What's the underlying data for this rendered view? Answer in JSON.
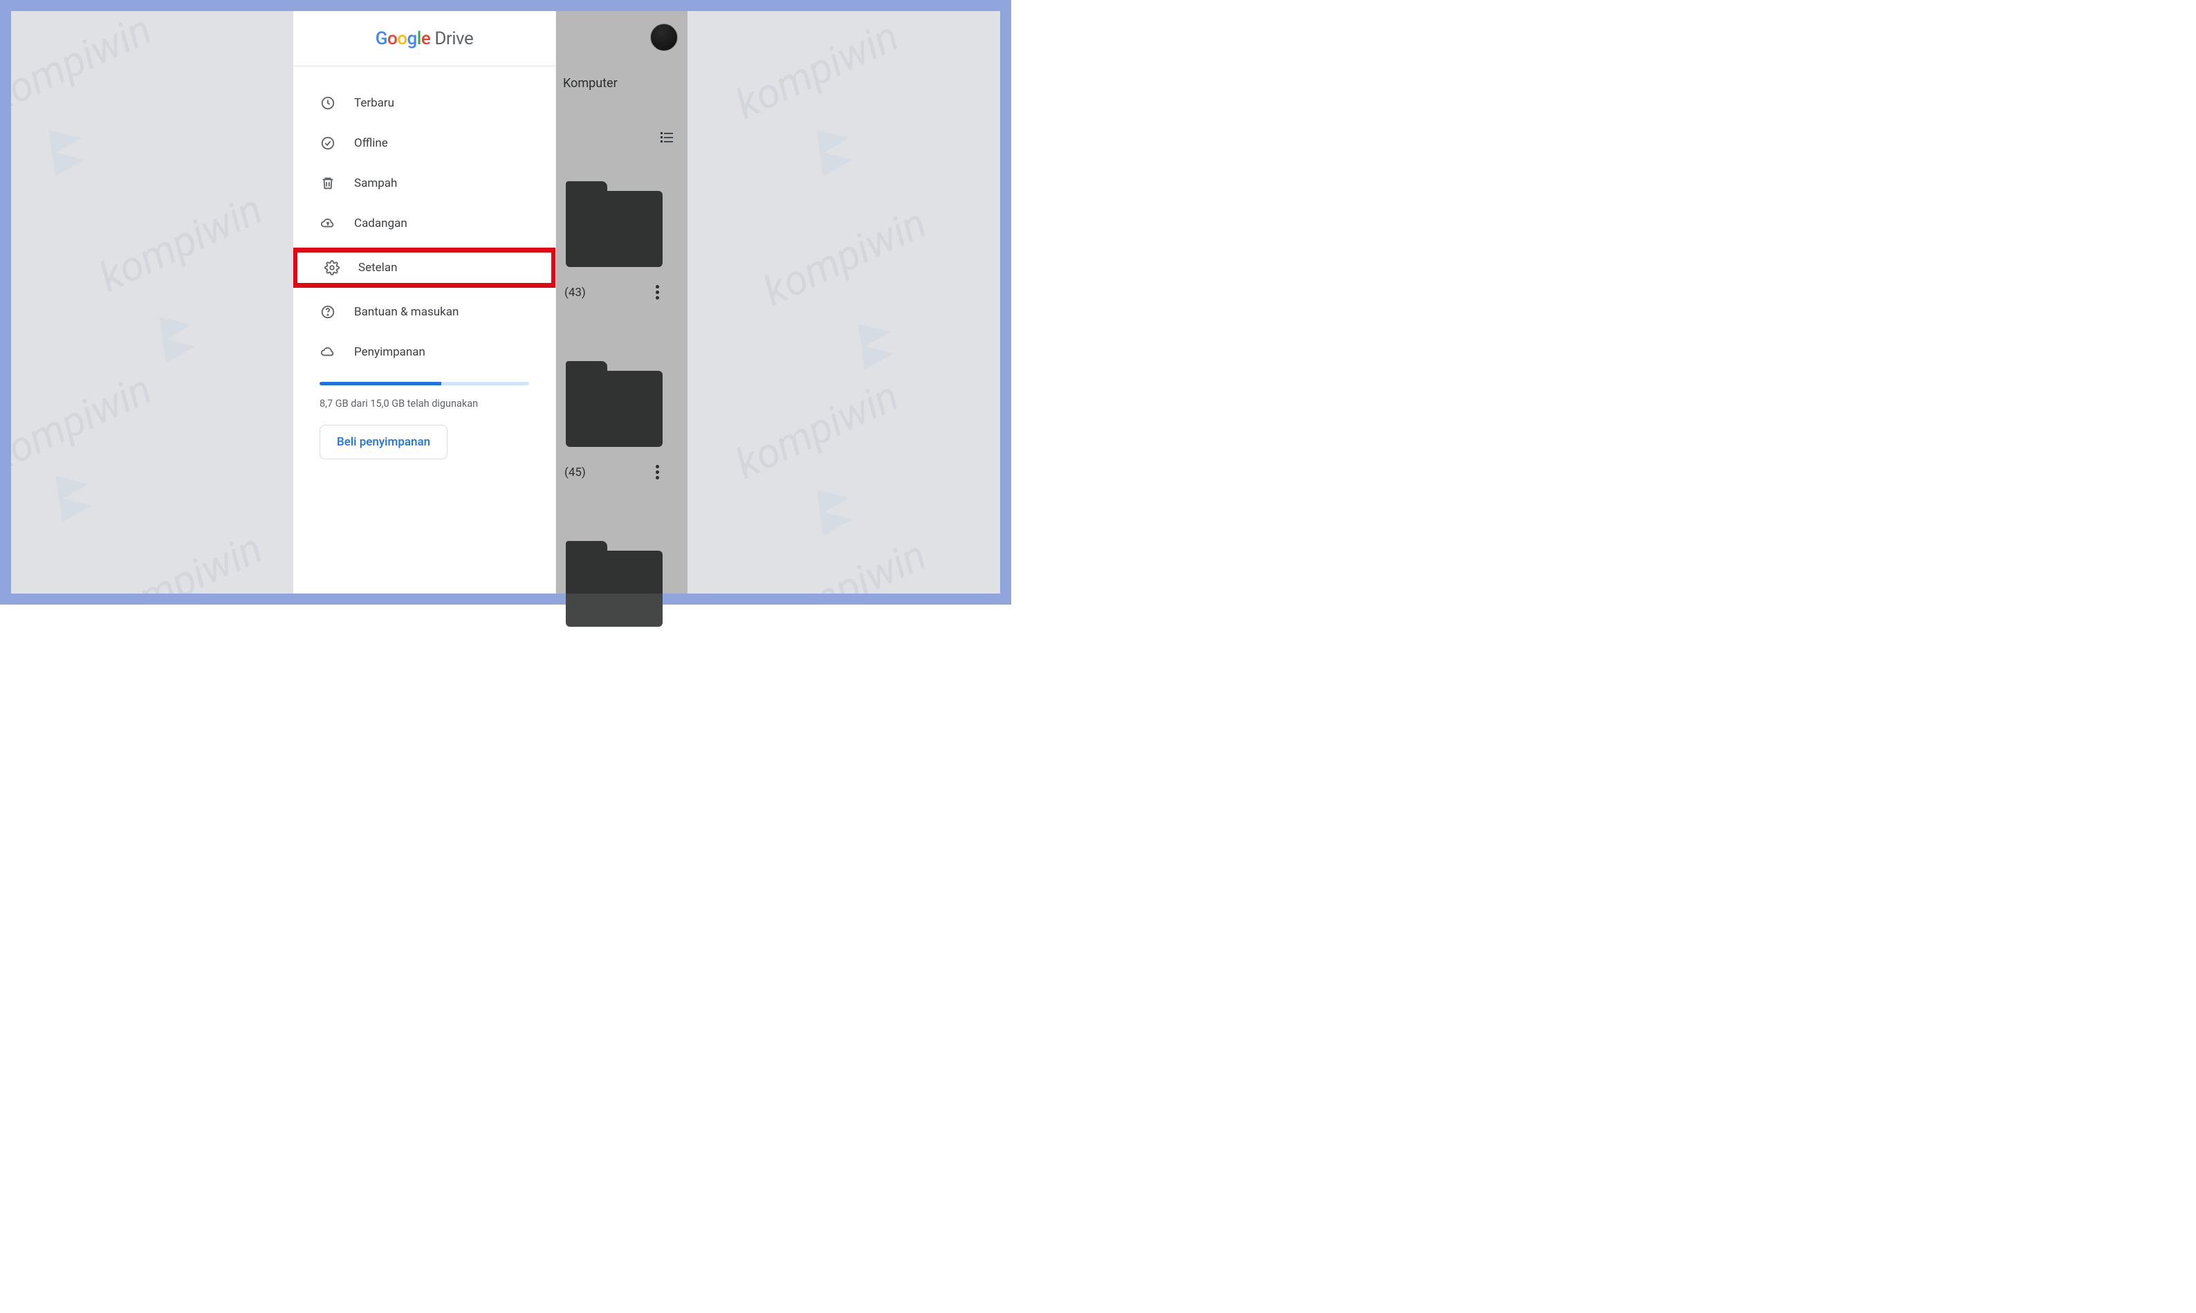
{
  "app": {
    "logo_first": "G",
    "logo_parts": [
      "o",
      "o",
      "g",
      "l",
      "e"
    ],
    "logo_drive": "Drive"
  },
  "menu": {
    "recent": "Terbaru",
    "offline": "Offline",
    "trash": "Sampah",
    "backups": "Cadangan",
    "settings": "Setelan",
    "help": "Bantuan & masukan",
    "storage": "Penyimpanan"
  },
  "storage": {
    "percent": 58,
    "used_text": "8,7 GB dari 15,0 GB telah digunakan",
    "buy_label": "Beli penyimpanan"
  },
  "content": {
    "tab_label": "Komputer",
    "folders": [
      {
        "name": "(43)"
      },
      {
        "name": "(45)"
      }
    ]
  },
  "watermark": "kompiwin",
  "colors": {
    "accent": "#1a73e8",
    "highlight": "#e30613"
  }
}
